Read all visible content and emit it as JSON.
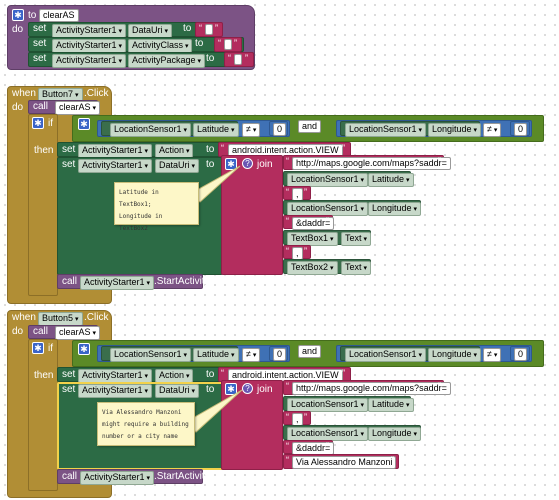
{
  "proc1": {
    "to": "to",
    "name": "clearAS",
    "do": "do",
    "set": "set",
    "to_kw": "to",
    "rows": [
      {
        "component": "ActivityStarter1",
        "property": "DataUri"
      },
      {
        "component": "ActivityStarter1",
        "property": "ActivityClass"
      },
      {
        "component": "ActivityStarter1",
        "property": "ActivityPackage"
      }
    ]
  },
  "event1": {
    "when": "when",
    "button": "Button7",
    "event": ".Click",
    "do": "do",
    "call": "call",
    "proc_name": "clearAS",
    "if": "if",
    "then": "then",
    "and": "and",
    "set": "set",
    "to": "to",
    "join": "join",
    "cond_left": {
      "component": "LocationSensor1",
      "property": "Latitude",
      "op": "≠",
      "value": "0"
    },
    "cond_right": {
      "component": "LocationSensor1",
      "property": "Longitude",
      "op": "≠",
      "value": "0"
    },
    "action_component": "ActivityStarter1",
    "action_property": "Action",
    "action_value": "android.intent.action.VIEW",
    "uri_component": "ActivityStarter1",
    "uri_property": "DataUri",
    "join_items": {
      "url": "http://maps.google.com/maps?saddr=",
      "lat_comp": "LocationSensor1",
      "lat_prop": "Latitude",
      "comma1": ",",
      "lon_comp": "LocationSensor1",
      "lon_prop": "Longitude",
      "daddr": "&daddr=",
      "tb1": "TextBox1",
      "tb1_prop": "Text",
      "comma2": ",",
      "tb2": "TextBox2",
      "tb2_prop": "Text"
    },
    "comment": [
      "Latitude in TextBox1;",
      "Longitude in TextBox2"
    ],
    "start_component": "ActivityStarter1",
    "start_method": ".StartActivity"
  },
  "event2": {
    "when": "when",
    "button": "Button5",
    "event": ".Click",
    "do": "do",
    "call": "call",
    "proc_name": "clearAS",
    "if": "if",
    "then": "then",
    "and": "and",
    "set": "set",
    "to": "to",
    "join": "join",
    "cond_left": {
      "component": "LocationSensor1",
      "property": "Latitude",
      "op": "≠",
      "value": "0"
    },
    "cond_right": {
      "component": "LocationSensor1",
      "property": "Longitude",
      "op": "≠",
      "value": "0"
    },
    "action_component": "ActivityStarter1",
    "action_property": "Action",
    "action_value": "android.intent.action.VIEW",
    "uri_component": "ActivityStarter1",
    "uri_property": "DataUri",
    "join_items": {
      "url": "http://maps.google.com/maps?saddr=",
      "lat_comp": "LocationSensor1",
      "lat_prop": "Latitude",
      "comma1": ",",
      "lon_comp": "LocationSensor1",
      "lon_prop": "Longitude",
      "daddr": "&daddr=",
      "address": "Via Alessandro Manzoni"
    },
    "comment": [
      "Via Alessandro Manzoni",
      "might require a building",
      "number or a city name"
    ],
    "start_component": "ActivityStarter1",
    "start_method": ".StartActivity"
  },
  "icons": {
    "gear": "gear-icon",
    "question": "question-mark-icon",
    "dropdown": "chevron-down-icon"
  },
  "colors": {
    "procedure": "#7c5385",
    "control": "#b18e35",
    "component": "#3a6e4c",
    "logic": "#5b8a27",
    "text": "#b32d5e",
    "math": "#3f71b5"
  }
}
